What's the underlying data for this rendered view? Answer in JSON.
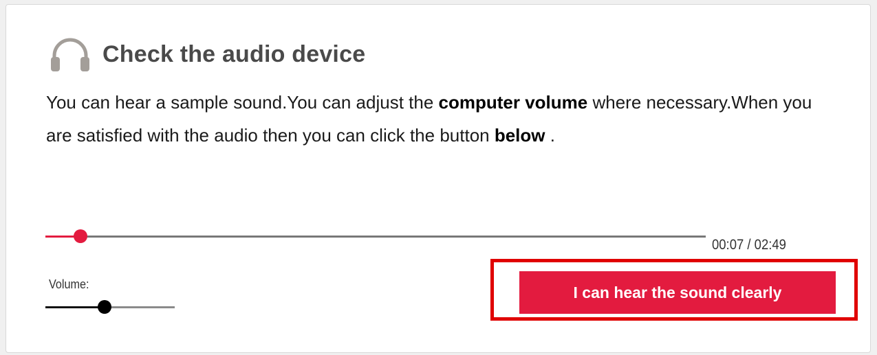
{
  "dialog": {
    "title": "Check the audio device",
    "icon": "headphones-icon",
    "instructions": {
      "part1": "You can hear a sample sound.You can adjust the ",
      "bold1": "computer volume",
      "part2": " where necessary.When you are satisfied with the audio then you can click the button ",
      "bold2": "below",
      "part3": " ."
    }
  },
  "player": {
    "current_time": "00:07",
    "separator": " / ",
    "total_time": "02:49",
    "progress_fraction": 0.053
  },
  "volume": {
    "label": "Volume:",
    "level_fraction": 0.46
  },
  "confirm_button": {
    "label": "I can hear the sound clearly"
  },
  "colors": {
    "accent": "#e31b3f",
    "highlight": "#e00000",
    "icon": "#a39e99",
    "title": "#4a4a4a"
  }
}
